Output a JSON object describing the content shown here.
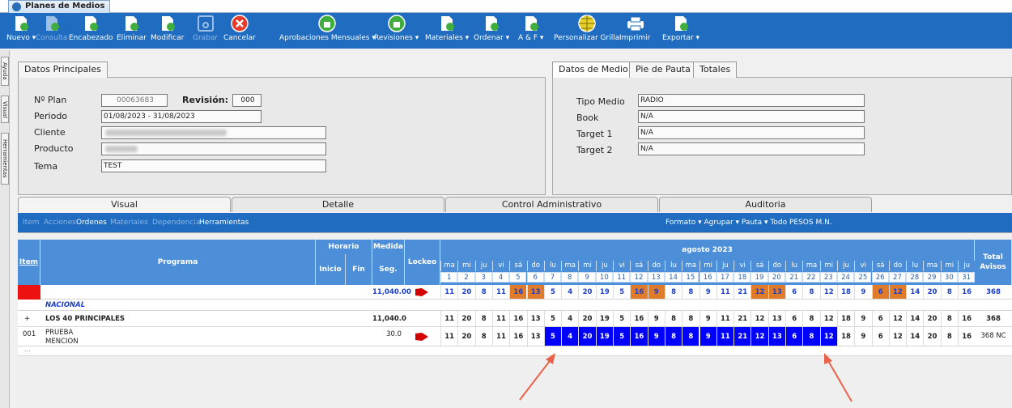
{
  "window": {
    "tab_title": "Planes de Medios"
  },
  "toolbar": [
    {
      "id": "nuevo",
      "label": "Nuevo ▾",
      "disabled": false,
      "icon": "new-doc-icon"
    },
    {
      "id": "consulta",
      "label": "Consulta",
      "disabled": true,
      "icon": "query-doc-icon"
    },
    {
      "id": "encabezado",
      "label": "Encabezado",
      "disabled": false,
      "icon": "header-edit-icon"
    },
    {
      "id": "eliminar",
      "label": "Eliminar",
      "disabled": false,
      "icon": "delete-doc-icon"
    },
    {
      "id": "modificar",
      "label": "Modificar",
      "disabled": false,
      "icon": "edit-doc-icon"
    },
    {
      "id": "grabar",
      "label": "Grabar",
      "disabled": true,
      "icon": "save-icon"
    },
    {
      "id": "cancelar",
      "label": "Cancelar",
      "disabled": false,
      "icon": "cancel-icon"
    },
    {
      "id": "aprobaciones",
      "label": "Aprobaciones Mensuales ▾",
      "disabled": false,
      "icon": "thumbs-up-icon"
    },
    {
      "id": "revisiones",
      "label": "Revisiones ▾",
      "disabled": false,
      "icon": "review-icon"
    },
    {
      "id": "materiales",
      "label": "Materiales ▾",
      "disabled": false,
      "icon": "materials-icon"
    },
    {
      "id": "ordenar",
      "label": "Ordenar ▾",
      "disabled": false,
      "icon": "order-icon"
    },
    {
      "id": "ayf",
      "label": "A & F ▾",
      "disabled": false,
      "icon": "af-icon"
    },
    {
      "id": "personalizar",
      "label": "Personalizar Grilla",
      "disabled": false,
      "icon": "globe-grid-icon"
    },
    {
      "id": "imprimir",
      "label": "Imprimir",
      "disabled": false,
      "icon": "printer-icon"
    },
    {
      "id": "exportar",
      "label": "Exportar ▾",
      "disabled": false,
      "icon": "export-icon"
    }
  ],
  "side_labels": [
    "Ayuda",
    "Visual",
    "Herramientas"
  ],
  "datos_principales": {
    "tab": "Datos Principales",
    "nro_plan_label": "Nº Plan",
    "nro_plan": "00063683",
    "revision_label": "Revisión:",
    "revision": "000",
    "periodo_label": "Periodo",
    "periodo": "01/08/2023 - 31/08/2023",
    "cliente_label": "Cliente",
    "producto_label": "Producto",
    "tema_label": "Tema",
    "tema": "TEST"
  },
  "datos_medio": {
    "tabs": [
      "Datos de Medio",
      "Pie de Pauta",
      "Totales"
    ],
    "tipo_medio_label": "Tipo Medio",
    "tipo_medio": "RADIO",
    "book_label": "Book",
    "book": "N/A",
    "target1_label": "Target 1",
    "target1": "N/A",
    "target2_label": "Target 2",
    "target2": "N/A"
  },
  "bottom_tabs": [
    "Visual",
    "Detalle",
    "Control Administrativo",
    "Auditoria"
  ],
  "subbar": {
    "left": [
      "Item",
      "Acciones",
      "Ordenes",
      "Materiales",
      "Dependencia",
      "Herramientas"
    ],
    "left_enabled": [
      false,
      false,
      true,
      false,
      false,
      true
    ],
    "right": "Formato ▾  Agrupar ▾  Pauta ▾  Todo  PESOS M.N."
  },
  "grid": {
    "headers": {
      "item": "Item",
      "programa": "Programa",
      "horario": "Horario",
      "inicio": "Inicio",
      "fin": "Fin",
      "medida": "Medida",
      "seg": "Seg.",
      "lockeo": "Lockeo",
      "month": "agosto 2023",
      "total": "Total",
      "avisos": "Avisos"
    },
    "weekdays": [
      "ma",
      "mi",
      "ju",
      "vi",
      "sá",
      "do",
      "lu",
      "ma",
      "mi",
      "ju",
      "vi",
      "sá",
      "do",
      "lu",
      "ma",
      "mi",
      "ju",
      "vi",
      "sá",
      "do",
      "lu",
      "ma",
      "mi",
      "ju",
      "vi",
      "sá",
      "do",
      "lu",
      "ma",
      "mi",
      "ju"
    ],
    "days": [
      "1",
      "2",
      "3",
      "4",
      "5",
      "6",
      "7",
      "8",
      "9",
      "10",
      "11",
      "12",
      "13",
      "14",
      "15",
      "16",
      "17",
      "18",
      "19",
      "20",
      "21",
      "22",
      "23",
      "24",
      "25",
      "26",
      "27",
      "28",
      "29",
      "30",
      "31"
    ],
    "weekend_idx": [
      4,
      5,
      11,
      12,
      18,
      19,
      25,
      26
    ],
    "total_row": {
      "seg": "11,040.00",
      "counts": [
        "11",
        "20",
        "8",
        "11",
        "16",
        "13",
        "5",
        "4",
        "20",
        "19",
        "5",
        "16",
        "9",
        "8",
        "8",
        "9",
        "11",
        "21",
        "12",
        "13",
        "6",
        "8",
        "12",
        "18",
        "9",
        "6",
        "12",
        "14",
        "20",
        "8",
        "16"
      ],
      "total": "368"
    },
    "nacional_label": "NACIONAL",
    "group_row": {
      "expand": "+",
      "programa": "LOS 40 PRINCIPALES",
      "seg": "11,040.0",
      "counts": [
        "11",
        "20",
        "8",
        "11",
        "16",
        "13",
        "5",
        "4",
        "20",
        "19",
        "5",
        "16",
        "9",
        "8",
        "8",
        "9",
        "11",
        "21",
        "12",
        "13",
        "6",
        "8",
        "12",
        "18",
        "9",
        "6",
        "12",
        "14",
        "20",
        "8",
        "16"
      ],
      "total": "368"
    },
    "item_row": {
      "item": "001",
      "programa": "PRUEBA",
      "subtext": "MENCION",
      "seg": "30.0",
      "counts": [
        "11",
        "20",
        "8",
        "11",
        "16",
        "13",
        "5",
        "4",
        "20",
        "19",
        "5",
        "16",
        "9",
        "8",
        "8",
        "9",
        "11",
        "21",
        "12",
        "13",
        "6",
        "8",
        "12",
        "18",
        "9",
        "6",
        "12",
        "14",
        "20",
        "8",
        "16"
      ],
      "selected_from": 6,
      "selected_to": 22,
      "total": "368",
      "extra": "NC"
    },
    "ellipsis": "..."
  },
  "colors": {
    "toolbar": "#1f6cc0",
    "header": "#4c8fd8",
    "weekend": "#e07b2a",
    "selected": "#0000ff",
    "flag": "#d40000",
    "arrow": "#e8634a"
  }
}
